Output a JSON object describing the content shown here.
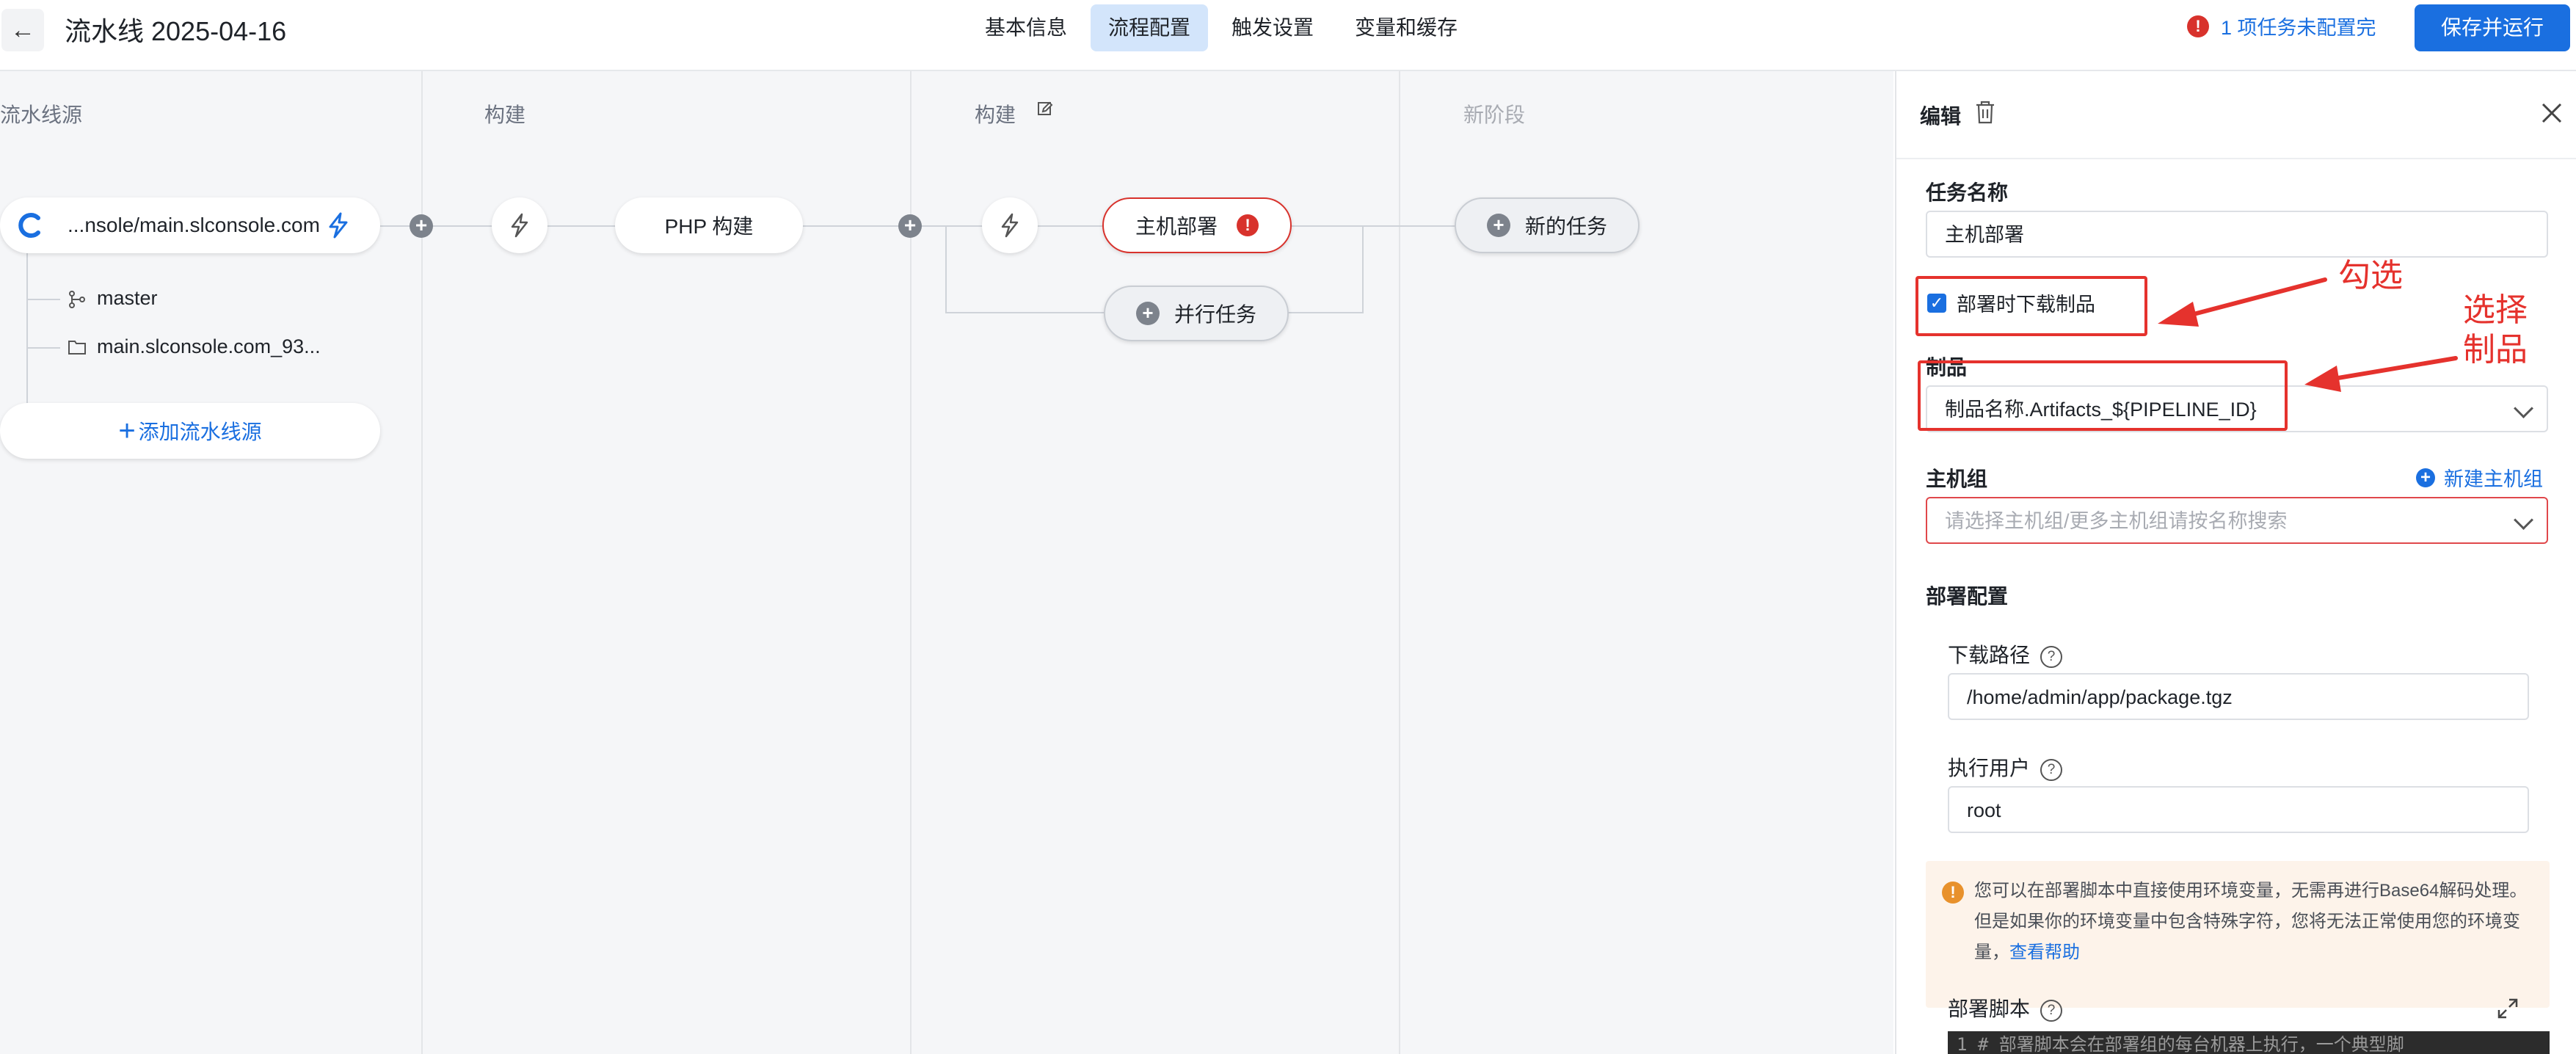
{
  "header": {
    "title": "流水线 2025-04-16",
    "tabs": [
      {
        "label": "基本信息"
      },
      {
        "label": "流程配置",
        "active": true
      },
      {
        "label": "触发设置"
      },
      {
        "label": "变量和缓存"
      }
    ],
    "warning_text": "1 项任务未配置完",
    "save_run_label": "保存并运行"
  },
  "stages": [
    {
      "title": "流水线源"
    },
    {
      "title": "构建"
    },
    {
      "title": "构建"
    },
    {
      "title": "新阶段"
    }
  ],
  "source": {
    "repo_label": "...nsole/main.slconsole.com",
    "branch": "master",
    "path": "main.slconsole.com_93...",
    "add_source_label": "添加流水线源"
  },
  "jobs": {
    "php_build": "PHP 构建",
    "host_deploy": "主机部署",
    "parallel_task": "并行任务",
    "new_task": "新的任务"
  },
  "panel": {
    "title": "编辑",
    "task_name_label": "任务名称",
    "task_name_value": "主机部署",
    "download_checkbox_label": "部署时下载制品",
    "download_checked": true,
    "artifact_label": "制品",
    "artifact_value": "制品名称.Artifacts_${PIPELINE_ID}",
    "host_group_label": "主机组",
    "new_host_group_label": "新建主机组",
    "host_group_placeholder": "请选择主机组/更多主机组请按名称搜索",
    "deploy_config_label": "部署配置",
    "download_path_label": "下载路径",
    "download_path_value": "/home/admin/app/package.tgz",
    "exec_user_label": "执行用户",
    "exec_user_value": "root",
    "tip_text": "您可以在部署脚本中直接使用环境变量，无需再进行Base64解码处理。但是如果你的环境变量中包含特殊字符，您将无法正常使用您的环境变量，",
    "tip_link": "查看帮助",
    "script_label": "部署脚本",
    "script_first_line": "1  # 部署脚本会在部署组的每台机器上执行，一个典型脚"
  },
  "annotations": {
    "check_note": "勾选",
    "select_note_line1": "选择",
    "select_note_line2": "制品"
  },
  "colors": {
    "primary": "#1a6fe0",
    "error": "#d8322c",
    "annotation": "#e5322d",
    "tab_active_bg": "#d3e5fb",
    "canvas_bg": "#f5f6f8"
  }
}
